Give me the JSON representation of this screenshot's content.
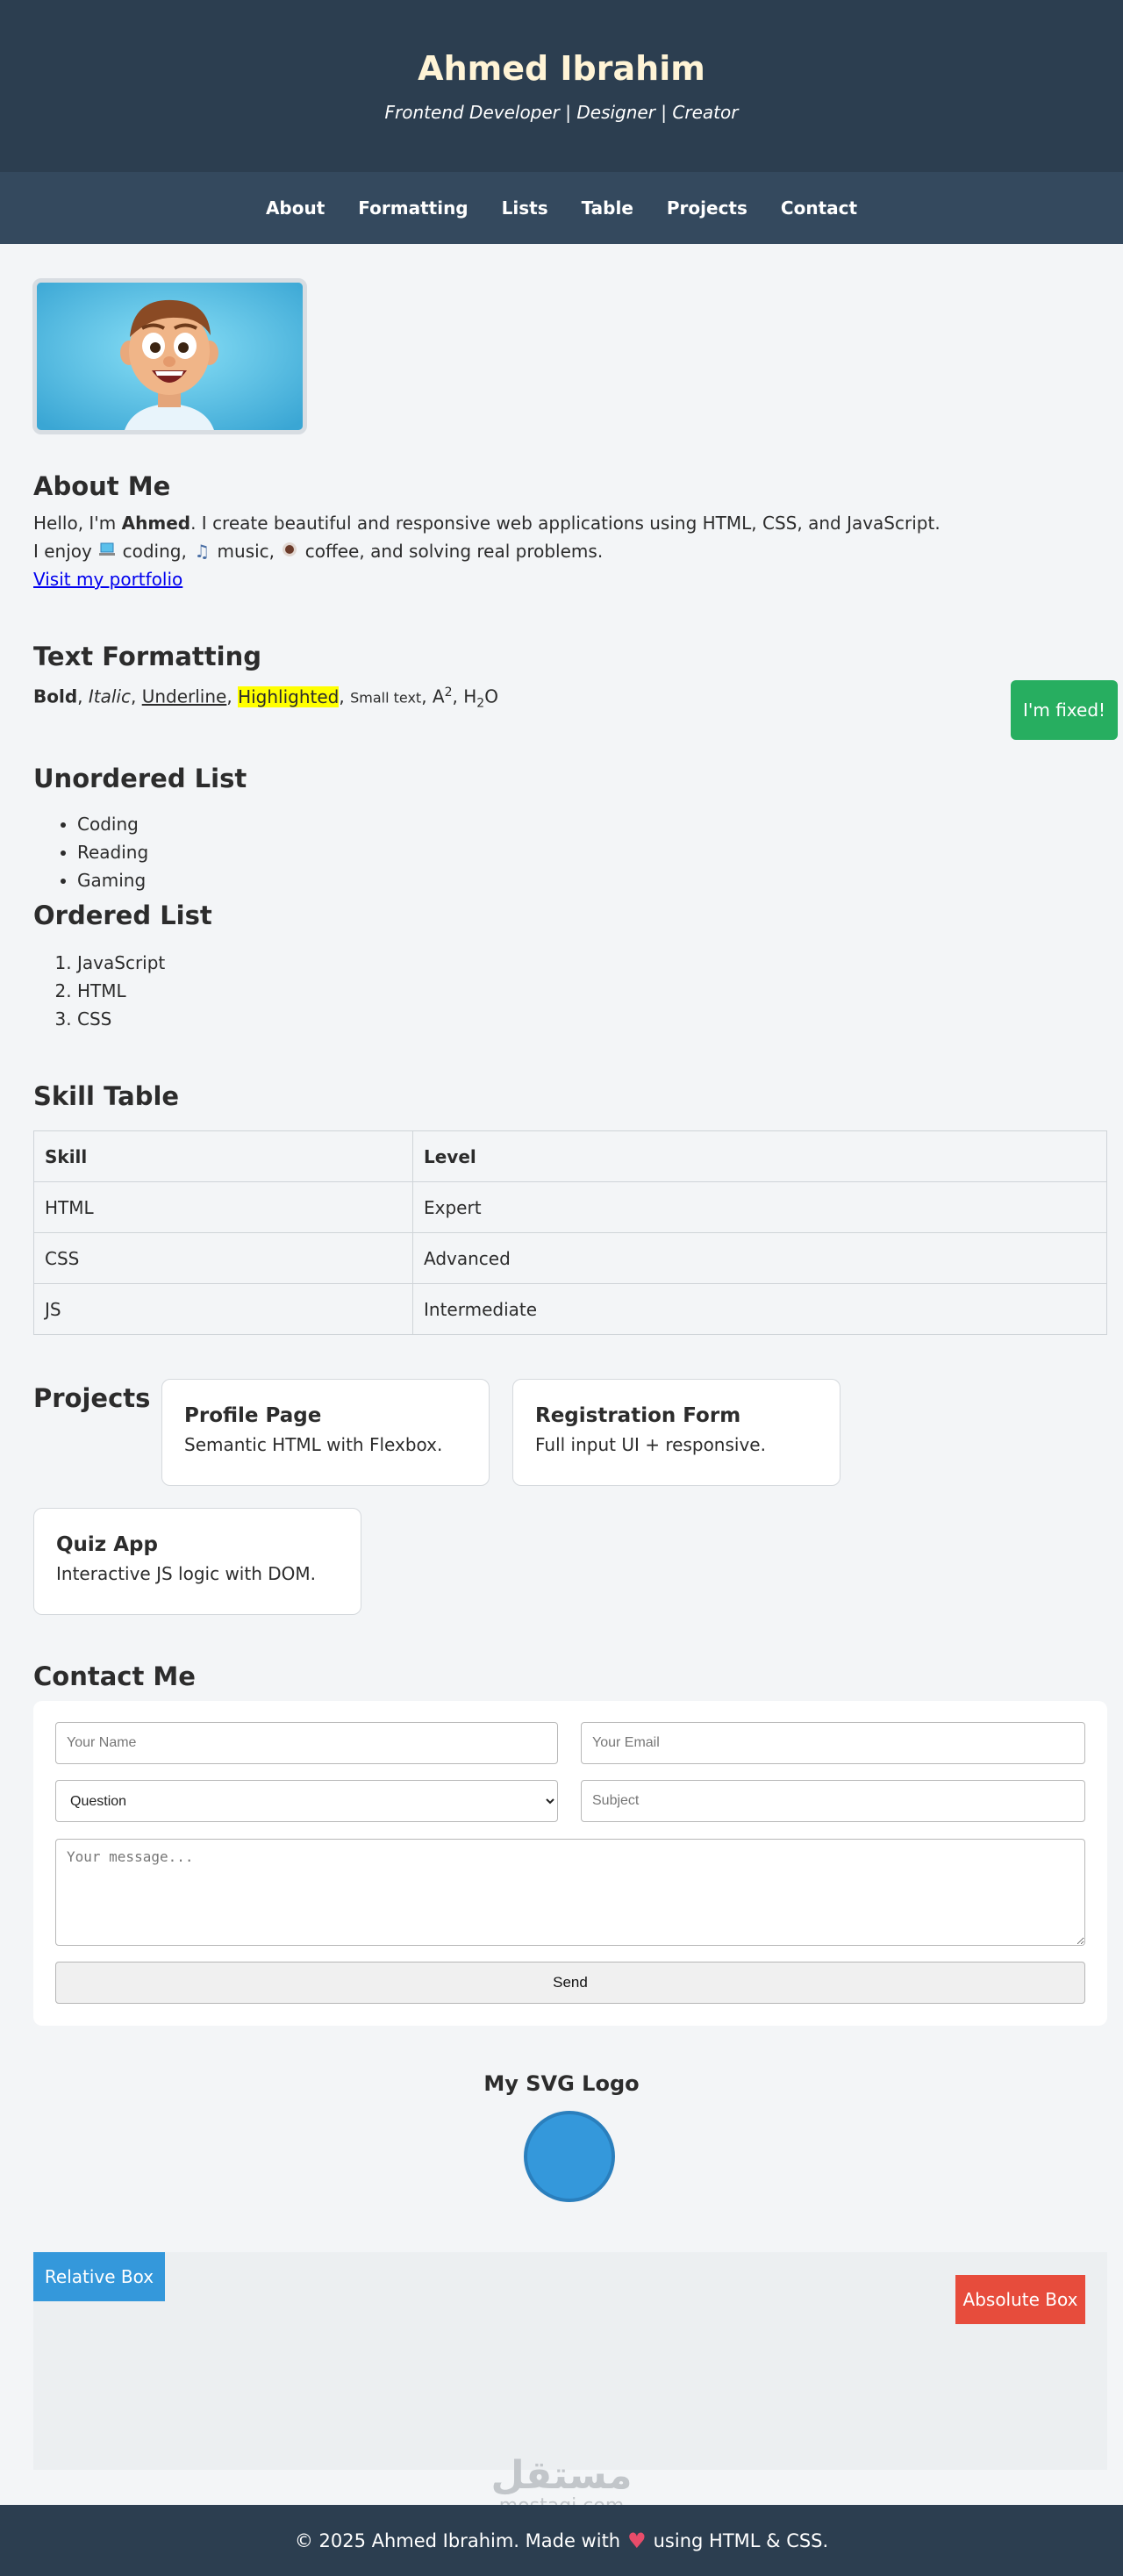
{
  "header": {
    "title": "Ahmed Ibrahim",
    "subtitle": "Frontend Developer | Designer | Creator"
  },
  "nav": [
    "About",
    "Formatting",
    "Lists",
    "Table",
    "Projects",
    "Contact"
  ],
  "about": {
    "heading": "About Me",
    "line1_pre": "Hello, I'm ",
    "name": "Ahmed",
    "line1_post": ". I create beautiful and responsive web applications using HTML, CSS, and JavaScript.",
    "line2_pre": "I enjoy ",
    "coding": " coding, ",
    "music": " music, ",
    "coffee": " coffee, and solving real problems.",
    "link": "Visit my portfolio",
    "icons": [
      "laptop-icon",
      "music-note-icon",
      "coffee-icon"
    ]
  },
  "formatting": {
    "heading": "Text Formatting",
    "bold": "Bold",
    "italic": "Italic",
    "underline": "Underline",
    "highlighted": "Highlighted",
    "small": "Small text",
    "sup_base": "A",
    "sup": "2",
    "sub_base": "H",
    "sub": "2",
    "sub_after": "O",
    "sep": ", "
  },
  "fixed_note": "I'm fixed!",
  "unordered": {
    "heading": "Unordered List",
    "items": [
      "Coding",
      "Reading",
      "Gaming"
    ]
  },
  "ordered": {
    "heading": "Ordered List",
    "items": [
      "JavaScript",
      "HTML",
      "CSS"
    ]
  },
  "skills": {
    "heading": "Skill Table",
    "headers": [
      "Skill",
      "Level"
    ],
    "rows": [
      [
        "HTML",
        "Expert"
      ],
      [
        "CSS",
        "Advanced"
      ],
      [
        "JS",
        "Intermediate"
      ]
    ]
  },
  "projects": {
    "heading": "Projects",
    "items": [
      {
        "title": "Profile Page",
        "desc": "Semantic HTML with Flexbox."
      },
      {
        "title": "Registration Form",
        "desc": "Full input UI + responsive."
      },
      {
        "title": "Quiz App",
        "desc": "Interactive JS logic with DOM."
      }
    ]
  },
  "contact": {
    "heading": "Contact Me",
    "name_placeholder": "Your Name",
    "email_placeholder": "Your Email",
    "select_value": "Question",
    "subject_placeholder": "Subject",
    "message_placeholder": "Your message...",
    "send": "Send"
  },
  "svg_logo": {
    "title": "My SVG Logo",
    "fill": "#3498db",
    "stroke": "#2a7fbd"
  },
  "positioning": {
    "relative": "Relative Box",
    "absolute": "Absolute Box"
  },
  "watermark": {
    "arabic": "مستقل",
    "latin": "mostaqi.com"
  },
  "footer": {
    "before": "© 2025 Ahmed Ibrahim. Made with",
    "after": "using HTML & CSS."
  },
  "colors": {
    "header_bg": "#2c3e50",
    "nav_bg": "#34495e",
    "fixed_green": "#27ae60",
    "relative_blue": "#3498db",
    "absolute_red": "#e74c3c"
  }
}
